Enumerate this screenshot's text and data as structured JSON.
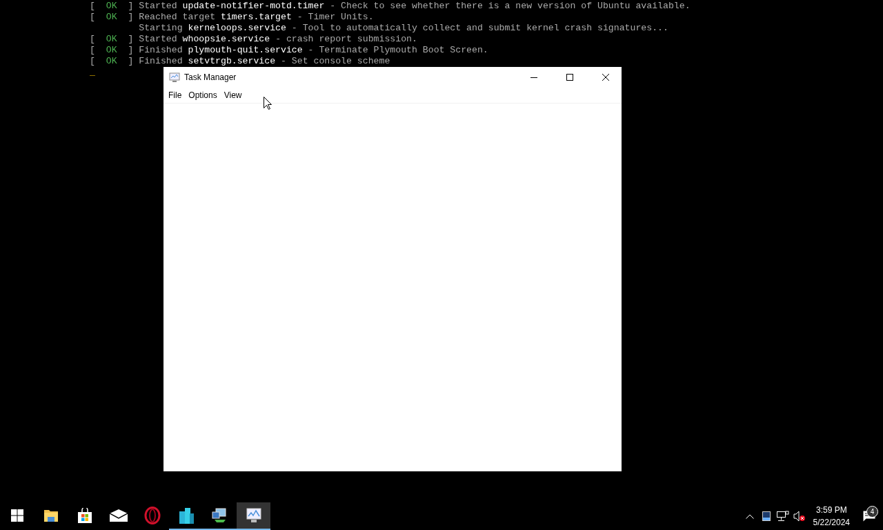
{
  "console": {
    "lines": [
      {
        "kind": "status",
        "open": "[",
        "status": "OK",
        "close": "]",
        "verb": "Started",
        "unit": "update-notifier-motd.timer",
        "description": "- Check to see whether there is a new version of Ubuntu available."
      },
      {
        "kind": "status",
        "open": "[",
        "status": "OK",
        "close": "]",
        "verb": "Reached target",
        "unit": "timers.target",
        "description": "- Timer Units."
      },
      {
        "kind": "plain",
        "verb": "Starting",
        "unit": "kerneloops.service",
        "description": "- Tool to automatically collect and submit kernel crash signatures..."
      },
      {
        "kind": "status",
        "open": "[",
        "status": "OK",
        "close": "]",
        "verb": "Started",
        "unit": "whoopsie.service",
        "description": "- crash report submission."
      },
      {
        "kind": "status",
        "open": "[",
        "status": "OK",
        "close": "]",
        "verb": "Finished",
        "unit": "plymouth-quit.service",
        "description": "- Terminate Plymouth Boot Screen."
      },
      {
        "kind": "status",
        "open": "[",
        "status": "OK",
        "close": "]",
        "verb": "Finished",
        "unit": "setvtrgb.service",
        "description": "- Set console scheme"
      }
    ],
    "cursor": "_"
  },
  "window": {
    "title": "Task Manager",
    "menu": [
      "File",
      "Options",
      "View"
    ]
  },
  "taskbar": {
    "apps": [
      {
        "kind": "folder",
        "running": false,
        "selected": false
      },
      {
        "kind": "store",
        "running": false,
        "selected": false
      },
      {
        "kind": "mail",
        "running": false,
        "selected": false
      },
      {
        "kind": "opera",
        "running": false,
        "selected": false
      },
      {
        "kind": "buildings",
        "running": true,
        "selected": false
      },
      {
        "kind": "network",
        "running": true,
        "selected": false
      },
      {
        "kind": "monitor",
        "running": true,
        "selected": true
      }
    ],
    "time": "3:59 PM",
    "date": "5/22/2024",
    "notifications": "4"
  }
}
